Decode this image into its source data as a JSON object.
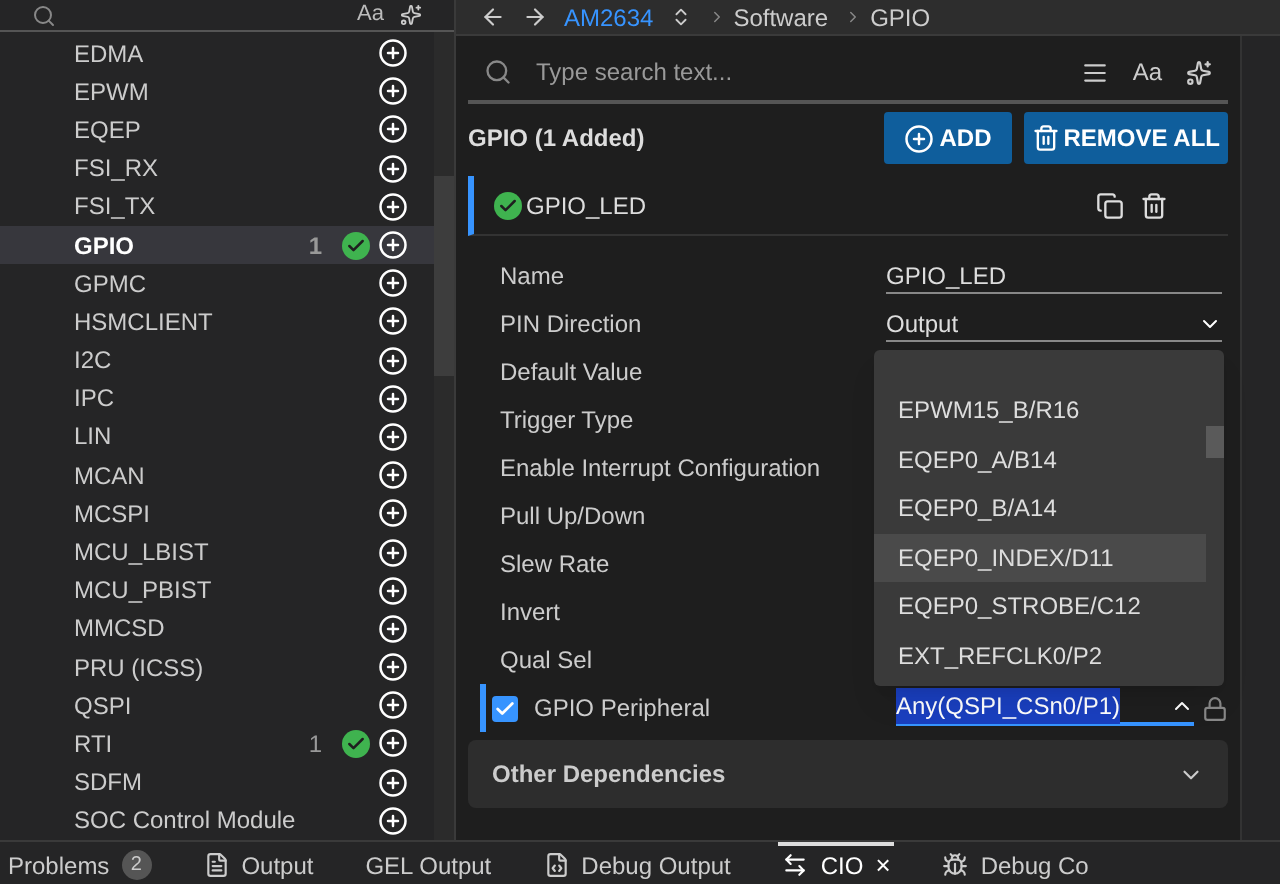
{
  "sidebar": {
    "toggle": "Aa",
    "items": [
      {
        "label": "EDMA",
        "added": false,
        "selected": false
      },
      {
        "label": "EPWM",
        "added": false,
        "selected": false
      },
      {
        "label": "EQEP",
        "added": false,
        "selected": false
      },
      {
        "label": "FSI_RX",
        "added": false,
        "selected": false
      },
      {
        "label": "FSI_TX",
        "added": false,
        "selected": false
      },
      {
        "label": "GPIO",
        "count": "1",
        "added": true,
        "selected": true
      },
      {
        "label": "GPMC",
        "added": false,
        "selected": false
      },
      {
        "label": "HSMCLIENT",
        "added": false,
        "selected": false
      },
      {
        "label": "I2C",
        "added": false,
        "selected": false
      },
      {
        "label": "IPC",
        "added": false,
        "selected": false
      },
      {
        "label": "LIN",
        "added": false,
        "selected": false
      },
      {
        "label": "MCAN",
        "added": false,
        "selected": false
      },
      {
        "label": "MCSPI",
        "added": false,
        "selected": false
      },
      {
        "label": "MCU_LBIST",
        "added": false,
        "selected": false
      },
      {
        "label": "MCU_PBIST",
        "added": false,
        "selected": false
      },
      {
        "label": "MMCSD",
        "added": false,
        "selected": false
      },
      {
        "label": "PRU (ICSS)",
        "added": false,
        "selected": false
      },
      {
        "label": "QSPI",
        "added": false,
        "selected": false
      },
      {
        "label": "RTI",
        "count": "1",
        "added": true,
        "selected": false
      },
      {
        "label": "SDFM",
        "added": false,
        "selected": false
      },
      {
        "label": "SOC Control Module",
        "added": false,
        "selected": false
      }
    ]
  },
  "breadcrumb": {
    "device": "AM2634",
    "path": [
      "Software",
      "GPIO"
    ]
  },
  "panel": {
    "search": {
      "placeholder": "Type search text..."
    },
    "toggle": "Aa",
    "title": "GPIO (1 Added)",
    "buttons": [
      "ADD",
      "REMOVE ALL"
    ],
    "instance": {
      "name": "GPIO_LED",
      "ok": true
    },
    "fields": [
      {
        "kind": "text",
        "label": "Name",
        "value": "GPIO_LED"
      },
      {
        "kind": "select",
        "label": "PIN Direction",
        "value": "Output"
      },
      {
        "kind": "plain",
        "label": "Default Value"
      },
      {
        "kind": "plain",
        "label": "Trigger Type"
      },
      {
        "kind": "plain",
        "label": "Enable Interrupt Configuration"
      },
      {
        "kind": "plain",
        "label": "Pull Up/Down"
      },
      {
        "kind": "plain",
        "label": "Slew Rate"
      },
      {
        "kind": "plain",
        "label": "Invert"
      },
      {
        "kind": "plain",
        "label": "Qual Sel"
      },
      {
        "kind": "peripheral",
        "label": "GPIO Peripheral",
        "value": "Any(QSPI_CSn0/P1)",
        "checked": true,
        "expanded": true,
        "locked": true
      }
    ],
    "options": [
      {
        "label": "EPWM15_B/R16",
        "highlighted": false
      },
      {
        "label": "EQEP0_A/B14",
        "highlighted": false
      },
      {
        "label": "EQEP0_B/A14",
        "highlighted": false
      },
      {
        "label": "EQEP0_INDEX/D11",
        "highlighted": true
      },
      {
        "label": "EQEP0_STROBE/C12",
        "highlighted": false
      },
      {
        "label": "EXT_REFCLK0/P2",
        "highlighted": false
      }
    ],
    "section": {
      "label": "Other Dependencies",
      "expanded": false
    }
  },
  "bottom_tabs": [
    {
      "kind": "problems",
      "label": "Problems",
      "badge": "2",
      "selected": false
    },
    {
      "kind": "output",
      "label": "Output",
      "selected": false
    },
    {
      "kind": "plain",
      "label": "GEL Output",
      "selected": false
    },
    {
      "kind": "debug",
      "label": "Debug Output",
      "selected": false
    },
    {
      "kind": "cio",
      "label": "CIO",
      "selected": true,
      "close": "×"
    },
    {
      "kind": "console",
      "label": "Debug Co",
      "selected": false
    }
  ]
}
